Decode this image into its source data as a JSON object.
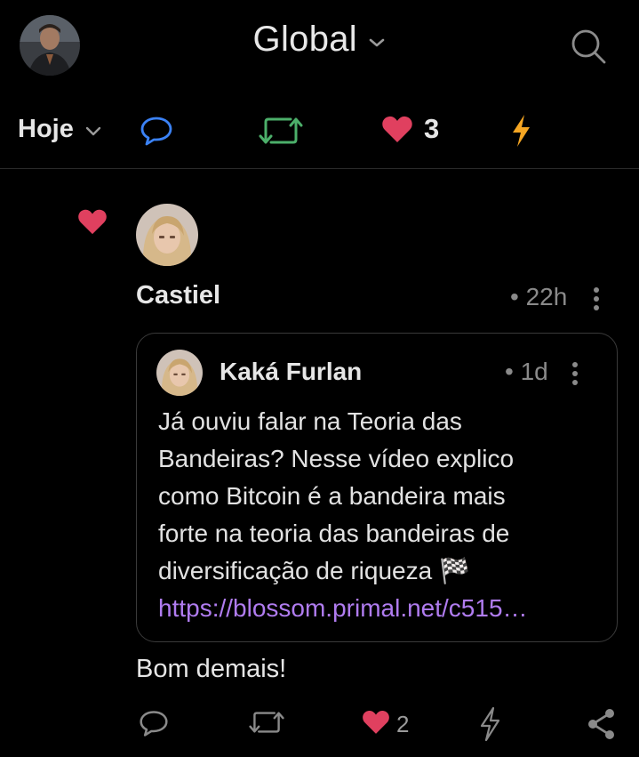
{
  "header": {
    "title": "Global",
    "avatar_icon": "user-avatar-icon",
    "search_icon": "search-icon"
  },
  "filter": {
    "period_label": "Hoje",
    "likes_count": "3",
    "colors": {
      "reply": "#3b82f6",
      "repost": "#4caf6a",
      "like": "#e0405f",
      "zap": "#f5a623"
    }
  },
  "post": {
    "author": "Castiel",
    "time": "• 22h",
    "comment": "Bom demais!",
    "quote": {
      "author": "Kaká Furlan",
      "time": "• 1d",
      "lines": [
        "Já ouviu falar na Teoria das",
        "Bandeiras? Nesse vídeo explico",
        "como Bitcoin é a bandeira mais",
        "forte na teoria das bandeiras de",
        "diversificação de riqueza 🏁"
      ],
      "link": "https://blossom.primal.net/c515…"
    },
    "actions": {
      "likes_count": "2"
    }
  }
}
